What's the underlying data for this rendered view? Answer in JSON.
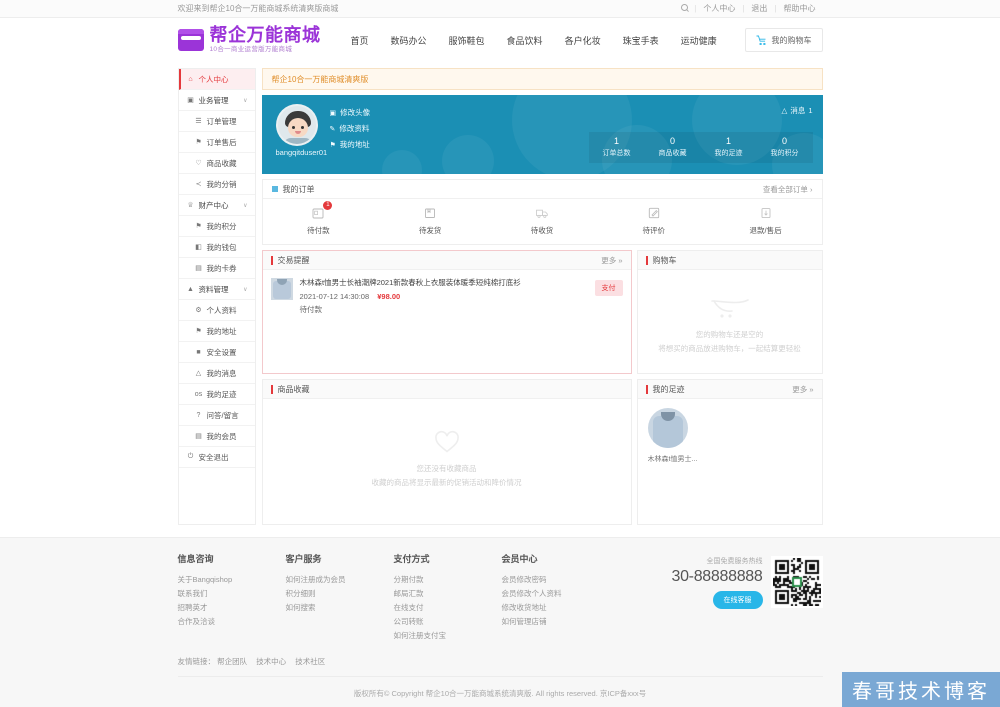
{
  "topbar": {
    "welcome": "欢迎来到帮企10合一万能商城系统清爽版商城",
    "search_icon": "search-icon",
    "links": [
      {
        "label": "个人中心"
      },
      {
        "label": "退出"
      },
      {
        "label": "帮助中心"
      }
    ]
  },
  "header": {
    "logo_title": "帮企万能商城",
    "logo_sub": "10合一商业运营版万能商城",
    "nav": [
      {
        "label": "首页"
      },
      {
        "label": "数码办公"
      },
      {
        "label": "服饰鞋包"
      },
      {
        "label": "食品饮料"
      },
      {
        "label": "各户化妆"
      },
      {
        "label": "珠宝手表"
      },
      {
        "label": "运动健康"
      }
    ],
    "cart_label": "我的购物车"
  },
  "sidebar": {
    "items": [
      {
        "label": "个人中心",
        "icon": "home-icon",
        "glyph": "⌂",
        "type": "active"
      },
      {
        "label": "业务管理",
        "icon": "box-icon",
        "glyph": "▣",
        "type": "group",
        "chevron": "∨"
      },
      {
        "label": "订单管理",
        "icon": "list-icon",
        "glyph": "☰",
        "type": "sub"
      },
      {
        "label": "订单售后",
        "icon": "service-icon",
        "glyph": "⚑",
        "type": "sub"
      },
      {
        "label": "商品收藏",
        "icon": "heart-icon",
        "glyph": "♡",
        "type": "sub"
      },
      {
        "label": "我的分销",
        "icon": "share-icon",
        "glyph": "≺",
        "type": "sub"
      },
      {
        "label": "财产中心",
        "icon": "trophy-icon",
        "glyph": "♕",
        "type": "group",
        "chevron": "∨"
      },
      {
        "label": "我的积分",
        "icon": "point-icon",
        "glyph": "⚑",
        "type": "sub"
      },
      {
        "label": "我的钱包",
        "icon": "wallet-icon",
        "glyph": "◧",
        "type": "sub"
      },
      {
        "label": "我的卡券",
        "icon": "coupon-icon",
        "glyph": "▤",
        "type": "sub"
      },
      {
        "label": "资料管理",
        "icon": "user-icon",
        "glyph": "▲",
        "type": "group",
        "chevron": "∨"
      },
      {
        "label": "个人资料",
        "icon": "gear-icon",
        "glyph": "⚙",
        "type": "sub"
      },
      {
        "label": "我的地址",
        "icon": "location-icon",
        "glyph": "⚑",
        "type": "sub"
      },
      {
        "label": "安全设置",
        "icon": "lock-icon",
        "glyph": "■",
        "type": "sub"
      },
      {
        "label": "我的消息",
        "icon": "bell-icon",
        "glyph": "△",
        "type": "sub"
      },
      {
        "label": "我的足迹",
        "icon": "footprint-icon",
        "glyph": "os",
        "type": "sub"
      },
      {
        "label": "问答/留言",
        "icon": "question-icon",
        "glyph": "?",
        "type": "sub"
      },
      {
        "label": "我的会员",
        "icon": "vip-icon",
        "glyph": "▤",
        "type": "sub"
      },
      {
        "label": "安全退出",
        "icon": "power-icon",
        "glyph": "⏻",
        "type": "plain"
      }
    ]
  },
  "notice": "帮企10合一万能商城清爽版",
  "banner": {
    "username": "bangqitduser01",
    "links": [
      {
        "label": "修改头像",
        "icon": "image-icon",
        "glyph": "▣"
      },
      {
        "label": "修改资料",
        "icon": "edit-icon",
        "glyph": "✎"
      },
      {
        "label": "我的地址",
        "icon": "location-icon",
        "glyph": "⚑"
      }
    ],
    "message_label": "消息",
    "message_count": "1",
    "message_icon": "bell-icon",
    "stats": [
      {
        "num": "1",
        "label": "订单总数"
      },
      {
        "num": "0",
        "label": "商品收藏"
      },
      {
        "num": "1",
        "label": "我的足迹"
      },
      {
        "num": "0",
        "label": "我的积分"
      }
    ],
    "bg_color": "#1b8fb4"
  },
  "orders": {
    "title": "我的订单",
    "view_all": "查看全部订单  ›",
    "tabs": [
      {
        "label": "待付款",
        "icon": "wallet-icon",
        "badge": "1"
      },
      {
        "label": "待发货",
        "icon": "package-icon",
        "badge": ""
      },
      {
        "label": "待收货",
        "icon": "truck-icon",
        "badge": ""
      },
      {
        "label": "待评价",
        "icon": "pencil-icon",
        "badge": ""
      },
      {
        "label": "退款/售后",
        "icon": "refund-icon",
        "badge": ""
      }
    ]
  },
  "trade": {
    "title": "交易提醒",
    "more": "更多 »",
    "item": {
      "name": "木林森t恤男士长袖潮牌2021新款春秋上衣服装体暖季短纯棉打底衫",
      "date": "2021-07-12 14:30:08",
      "price": "¥98.00",
      "status": "待付款",
      "action": "支付"
    }
  },
  "cart": {
    "title": "购物车",
    "icon": "cart-icon",
    "empty_title": "您的购物车还是空的",
    "empty_sub": "将想买的商品放进购物车，一起结算更轻松"
  },
  "favorites": {
    "title": "商品收藏",
    "icon": "heart-icon",
    "empty_title": "您还没有收藏商品",
    "empty_sub": "收藏的商品将显示最新的促销活动和降价情况"
  },
  "footprint": {
    "title": "我的足迹",
    "more": "更多 »",
    "items": [
      {
        "name": "木林森t恤男士..."
      }
    ]
  },
  "footer": {
    "columns": [
      {
        "title": "信息咨询",
        "links": [
          {
            "label": "关于Bangqishop"
          },
          {
            "label": "联系我们"
          },
          {
            "label": "招聘英才"
          },
          {
            "label": "合作及洽谈"
          }
        ]
      },
      {
        "title": "客户服务",
        "links": [
          {
            "label": "如何注册成为会员"
          },
          {
            "label": "积分细则"
          },
          {
            "label": "如何搜索"
          }
        ]
      },
      {
        "title": "支付方式",
        "links": [
          {
            "label": "分期付款"
          },
          {
            "label": "邮局汇款"
          },
          {
            "label": "在线支付"
          },
          {
            "label": "公司转账"
          },
          {
            "label": "如何注册支付宝"
          }
        ]
      },
      {
        "title": "会员中心",
        "links": [
          {
            "label": "会员修改密码"
          },
          {
            "label": "会员修改个人资料"
          },
          {
            "label": "修改收货地址"
          },
          {
            "label": "如何管理店铺"
          }
        ]
      }
    ],
    "hotline_title": "全国免费服务热线",
    "hotline_number": "30-88888888",
    "kefu_label": "在线客服",
    "qr_name": "qr-code",
    "friend_links_label": "友情链接：",
    "friend_links": [
      {
        "label": "帮企团队"
      },
      {
        "label": "技术中心"
      },
      {
        "label": "技术社区"
      }
    ],
    "copyright": "版权所有© Copyright 帮企10合一万能商城系统清爽版. All rights reserved. 京ICP备xxx号"
  },
  "watermark": "春哥技术博客"
}
